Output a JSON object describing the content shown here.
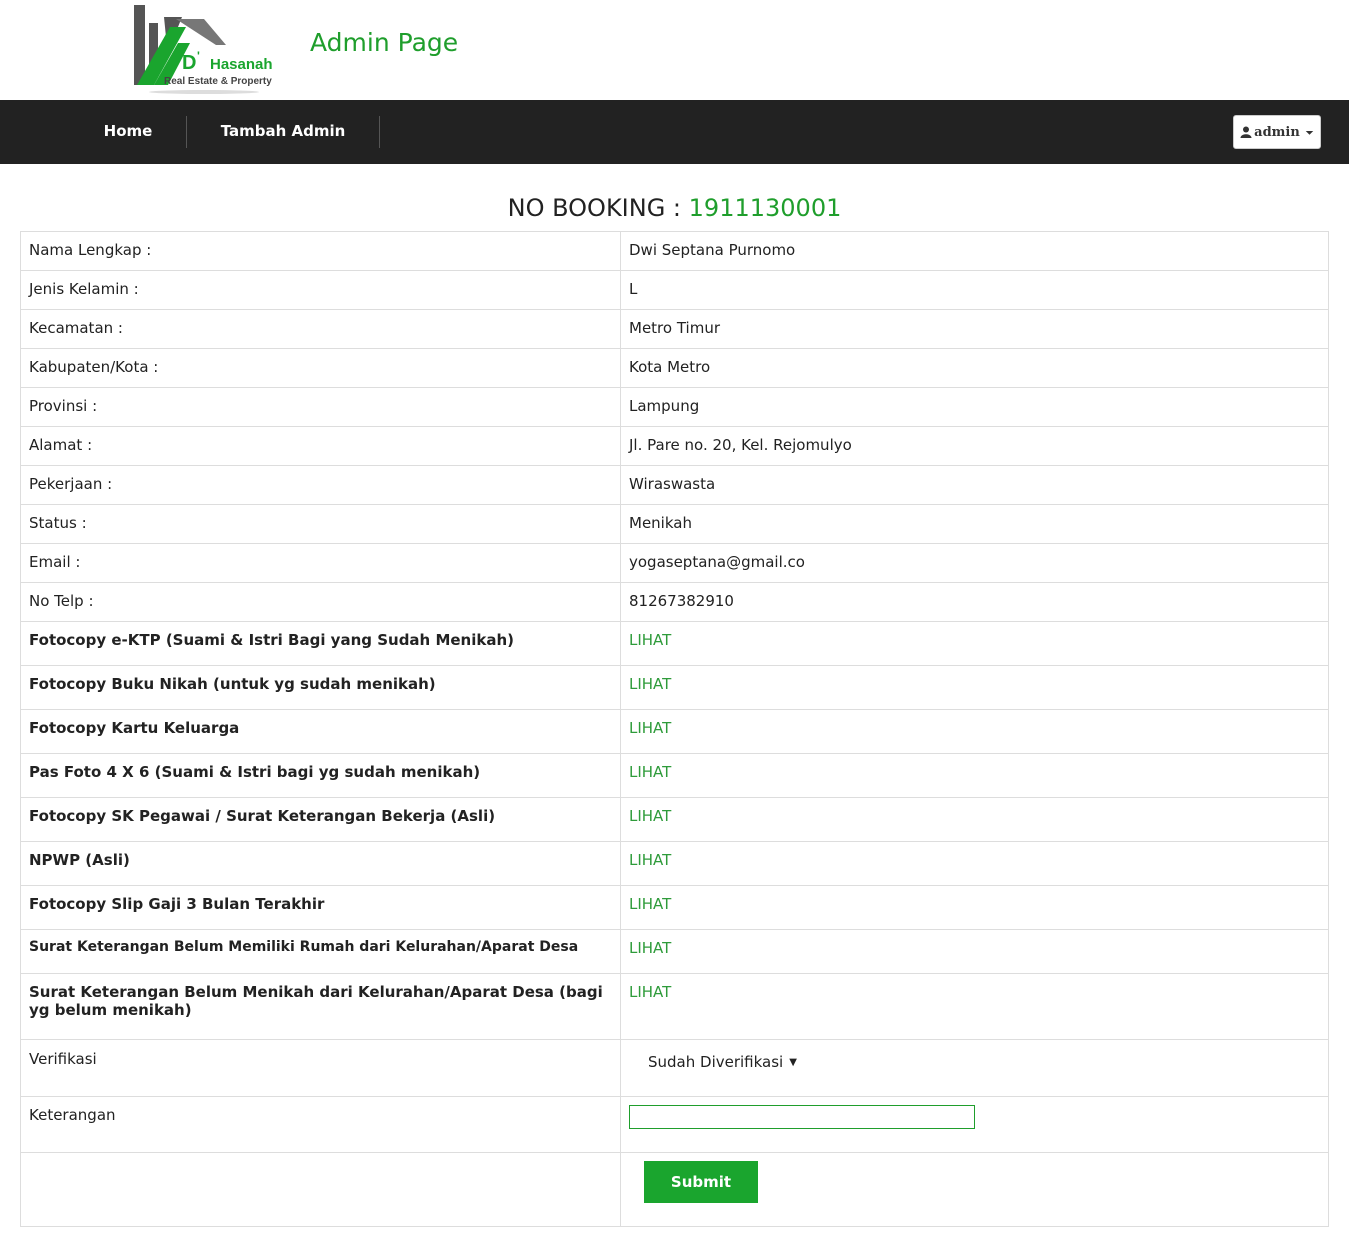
{
  "brand": {
    "logo_name": "D'Hasanah",
    "logo_tagline": "Real Estate & Property",
    "page_title": "Admin Page"
  },
  "nav": {
    "home_label": "Home",
    "add_admin_label": "Tambah Admin",
    "user_label": "admin"
  },
  "booking": {
    "label": "NO BOOKING : ",
    "number": "1911130001"
  },
  "info_rows": [
    {
      "label": "Nama Lengkap :",
      "value": "Dwi Septana Purnomo"
    },
    {
      "label": "Jenis Kelamin :",
      "value": "L"
    },
    {
      "label": "Kecamatan :",
      "value": "Metro Timur"
    },
    {
      "label": "Kabupaten/Kota :",
      "value": "Kota Metro"
    },
    {
      "label": "Provinsi :",
      "value": "Lampung"
    },
    {
      "label": "Alamat :",
      "value": "Jl. Pare no. 20, Kel. Rejomulyo"
    },
    {
      "label": "Pekerjaan :",
      "value": "Wiraswasta"
    },
    {
      "label": "Status :",
      "value": "Menikah"
    },
    {
      "label": "Email :",
      "value": "yogaseptana@gmail.co"
    },
    {
      "label": "No Telp :",
      "value": "81267382910"
    }
  ],
  "documents": [
    {
      "label": "Fotocopy e-KTP (Suami & Istri Bagi yang Sudah Menikah)",
      "link": "LIHAT"
    },
    {
      "label": "Fotocopy Buku Nikah (untuk yg sudah menikah)",
      "link": "LIHAT"
    },
    {
      "label": "Fotocopy Kartu Keluarga",
      "link": "LIHAT"
    },
    {
      "label": "Pas Foto 4 X 6 (Suami & Istri bagi yg sudah menikah)",
      "link": "LIHAT"
    },
    {
      "label": "Fotocopy SK Pegawai / Surat Keterangan Bekerja (Asli)",
      "link": "LIHAT"
    },
    {
      "label": "NPWP (Asli)",
      "link": "LIHAT"
    },
    {
      "label": "Fotocopy Slip Gaji 3 Bulan Terakhir",
      "link": "LIHAT"
    },
    {
      "label": "Surat Keterangan Belum Memiliki Rumah dari Kelurahan/Aparat Desa",
      "link": "LIHAT"
    },
    {
      "label": "Surat Keterangan Belum Menikah dari Kelurahan/Aparat Desa (bagi yg belum menikah)",
      "link": "LIHAT"
    }
  ],
  "form": {
    "verifikasi_label": "Verifikasi",
    "verifikasi_value": "Sudah Diverifikasi",
    "keterangan_label": "Keterangan",
    "keterangan_value": "",
    "submit_label": "Submit"
  },
  "colors": {
    "accent": "#1f9e2c",
    "navbar": "#222222"
  }
}
